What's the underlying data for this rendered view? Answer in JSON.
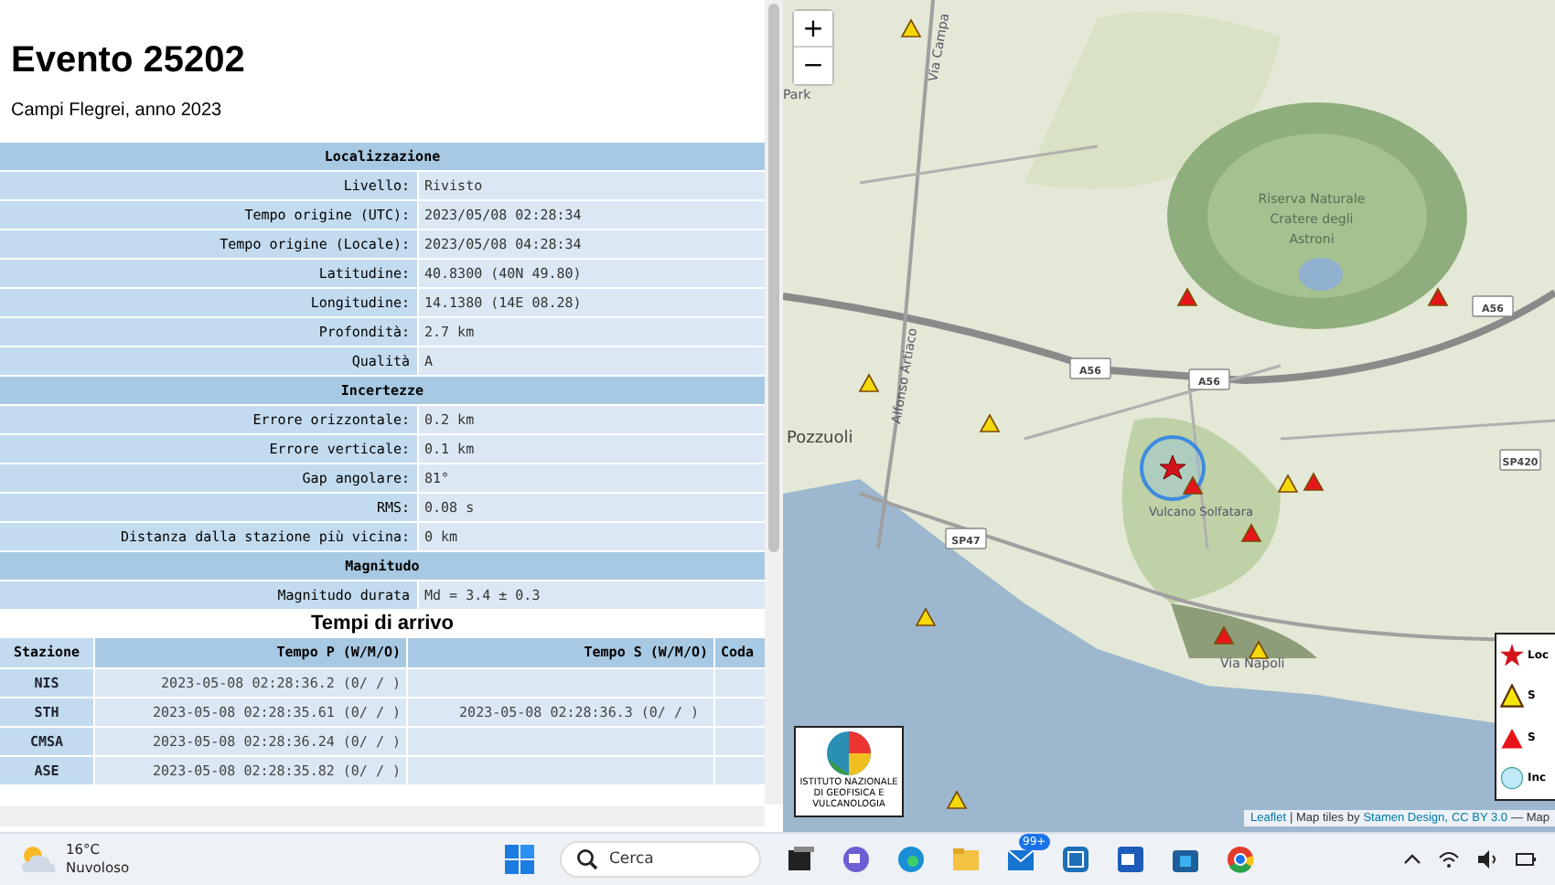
{
  "event": {
    "title": "Evento 25202",
    "subtitle": "Campi Flegrei, anno 2023"
  },
  "details": [
    {
      "kind": "section",
      "label": "Localizzazione"
    },
    {
      "kind": "row",
      "label": "Livello:",
      "value": "Rivisto"
    },
    {
      "kind": "row",
      "label": "Tempo origine (UTC):",
      "value": "2023/05/08 02:28:34"
    },
    {
      "kind": "row",
      "label": "Tempo origine (Locale):",
      "value": "2023/05/08 04:28:34"
    },
    {
      "kind": "row",
      "label": "Latitudine:",
      "value": "40.8300 (40N 49.80)"
    },
    {
      "kind": "row",
      "label": "Longitudine:",
      "value": "14.1380 (14E 08.28)"
    },
    {
      "kind": "row",
      "label": "Profondità:",
      "value": "2.7 km"
    },
    {
      "kind": "row",
      "label": "Qualità",
      "value": "A"
    },
    {
      "kind": "section",
      "label": "Incertezze"
    },
    {
      "kind": "row",
      "label": "Errore orizzontale:",
      "value": "0.2 km"
    },
    {
      "kind": "row",
      "label": "Errore verticale:",
      "value": "0.1 km"
    },
    {
      "kind": "row",
      "label": "Gap angolare:",
      "value": "81°"
    },
    {
      "kind": "row",
      "label": "RMS:",
      "value": "0.08 s"
    },
    {
      "kind": "row",
      "label": "Distanza dalla stazione più vicina:",
      "value": "0 km"
    },
    {
      "kind": "section",
      "label": "Magnitudo"
    },
    {
      "kind": "row",
      "label": "Magnitudo durata",
      "value": "Md = 3.4 ± 0.3"
    }
  ],
  "arrivals": {
    "title": "Tempi di arrivo",
    "columns": [
      "Stazione",
      "Tempo P (W/M/O)",
      "Tempo S (W/M/O)",
      "Coda"
    ],
    "rows": [
      [
        "NIS",
        "2023-05-08 02:28:36.2 (0/ / )",
        "",
        ""
      ],
      [
        "STH",
        "2023-05-08 02:28:35.61 (0/ / )",
        "2023-05-08 02:28:36.3 (0/ / )",
        ""
      ],
      [
        "CMSA",
        "2023-05-08 02:28:36.24 (0/ / )",
        "",
        ""
      ],
      [
        "ASE",
        "2023-05-08 02:28:35.82 (0/ / )",
        "",
        ""
      ]
    ]
  },
  "map": {
    "zoom_in": "+",
    "zoom_out": "−",
    "labels": [
      "Park",
      "Via Campa",
      "Alfonso Artiaco",
      "Riserva Naturale",
      "Cratere degli",
      "Astroni",
      "Pozzuoli",
      "Vulcano Solfatara",
      "Via Napoli"
    ],
    "road_shields": [
      "A56",
      "A56",
      "A56",
      "SP47",
      "SP420"
    ],
    "stations": [
      {
        "color": "#f5d90a"
      },
      {
        "color": "#f5d90a"
      },
      {
        "color": "#f5d90a"
      },
      {
        "color": "#e8141b"
      },
      {
        "color": "#e8141b"
      },
      {
        "color": "#e8141b"
      },
      {
        "color": "#f5d90a"
      },
      {
        "color": "#e8141b"
      },
      {
        "color": "#e8141b"
      },
      {
        "color": "#f5d90a"
      },
      {
        "color": "#e8141b"
      },
      {
        "color": "#f5d90a"
      },
      {
        "color": "#f5d90a"
      }
    ],
    "logo_text": "ISTITUTO NAZIONALE DI GEOFISICA E VULCANOLOGIA",
    "legend": [
      {
        "kind": "star",
        "label": "Loc"
      },
      {
        "kind": "yellow",
        "label": "S"
      },
      {
        "kind": "red",
        "label": "S"
      },
      {
        "kind": "circle",
        "label": "Inc"
      }
    ],
    "attribution": {
      "leaflet": "Leaflet",
      "sep": "| Map tiles by",
      "stamen": "Stamen Design,",
      "cc": "CC BY 3.0",
      "rest": "— Map"
    }
  },
  "taskbar": {
    "temperature": "16°C",
    "weather": "Nuvoloso",
    "search_placeholder": "Cerca",
    "mail_badge": "99+"
  }
}
